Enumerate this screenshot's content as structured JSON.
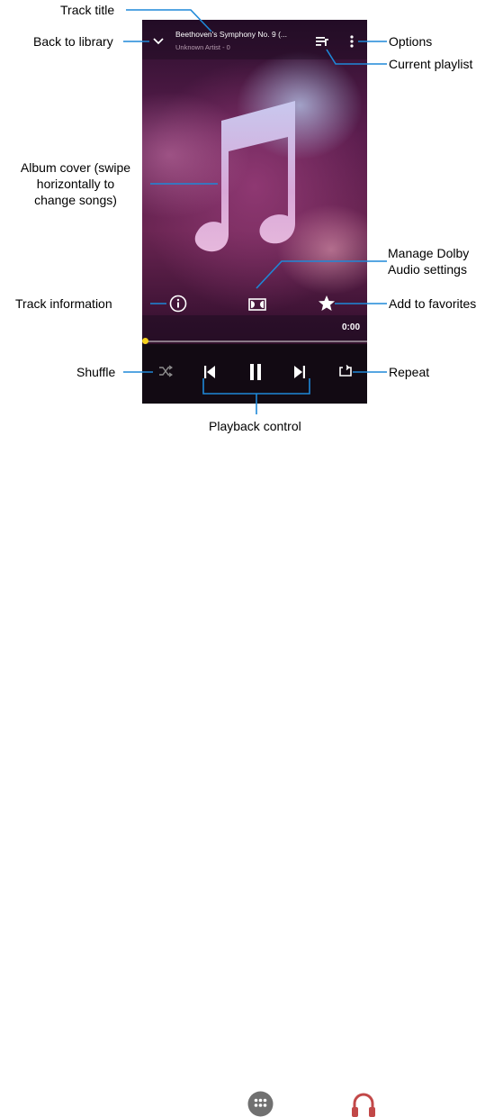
{
  "player": {
    "track_title": "Beethoven's Symphony No. 9 (...",
    "track_subtitle": "Unknown Artist - 0",
    "elapsed_time": "0:00",
    "progress": 0,
    "accent_color": "#f6d21c"
  },
  "icons": {
    "back": "chevron-down-icon",
    "playlist": "playlist-icon",
    "options": "more-vert-icon",
    "album_cover": "music-note-icon",
    "info": "info-icon",
    "dolby": "dolby-icon",
    "favorite": "star-icon",
    "shuffle": "shuffle-icon",
    "previous": "skip-previous-icon",
    "pause": "pause-icon",
    "next": "skip-next-icon",
    "repeat": "repeat-icon",
    "apps": "apps-icon",
    "headphones": "headphones-icon"
  },
  "annotations": {
    "track_title": "Track title",
    "back_to_library": "Back to library",
    "options": "Options",
    "current_playlist": "Current playlist",
    "album_cover": [
      "Album cover (swipe",
      "horizontally to",
      "change songs)"
    ],
    "dolby": [
      "Manage Dolby",
      "Audio settings"
    ],
    "track_information": "Track information",
    "add_to_favorites": "Add to favorites",
    "shuffle": "Shuffle",
    "repeat": "Repeat",
    "playback_control": "Playback control"
  }
}
